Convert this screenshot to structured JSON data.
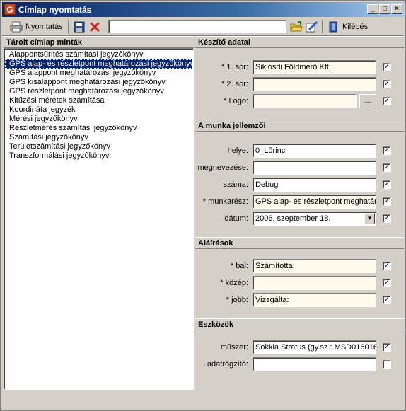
{
  "window": {
    "title": "Címlap nyomtatás",
    "app_icon_letter": "G",
    "controls": [
      "_",
      "□",
      "×"
    ]
  },
  "toolbar": {
    "print_label": "Nyomtatás",
    "search_value": "",
    "exit_label": "Kilépés"
  },
  "left": {
    "header": "Tárolt címlap minták",
    "items": [
      "Alappontsűrítés számítási jegyzőkönyv",
      "GPS alap- és részletpont meghatározási jegyzőkönyv",
      "GPS alappont meghatározási jegyzőkönyv",
      "GPS kisalappont meghatározási jegyzőkönyv",
      "GPS részletpont meghatározási jegyzőkönyv",
      "Kitűzési méretek számítása",
      "Koordináta jegyzék",
      "Mérési jegyzőkönyv",
      "Részletmérés számítási jegyzőkönyv",
      "Számítási jegyzőkönyv",
      "Területszámítási jegyzőkönyv",
      "Transzformálási jegyzőkönyv"
    ],
    "selected_index": 1
  },
  "sections": {
    "keszito": {
      "header": "Készítő adatai",
      "row1_label": "* 1. sor:",
      "row1_value": "Siklósdi Földmérő Kft.",
      "row1_checked": "✓",
      "row2_label": "* 2. sor:",
      "row2_value": "",
      "row2_checked": "✓",
      "logo_label": "* Logo:",
      "logo_value": "",
      "logo_browse": "...",
      "logo_checked": "✓"
    },
    "munka": {
      "header": "A munka jellemzői",
      "helye_label": "helye:",
      "helye_value": "0_Lőrinci",
      "helye_checked": "✓",
      "megnevezes_label": "megnevezése:",
      "megnevezes_value": "",
      "megnevezes_checked": "✓",
      "szama_label": "száma:",
      "szama_value": "Debug",
      "szama_checked": "✓",
      "munkaresz_label": "* munkarész:",
      "munkaresz_value": "GPS alap- és részletpont meghatáro",
      "munkaresz_checked": "✓",
      "datum_label": "dátum:",
      "datum_value": "2006. szeptember 18.",
      "datum_checked": "✓"
    },
    "alairasok": {
      "header": "Aláírások",
      "bal_label": "* bal:",
      "bal_value": "Számította:",
      "bal_checked": "✓",
      "kozep_label": "* közép:",
      "kozep_value": "",
      "kozep_checked": "✓",
      "jobb_label": "* jobb:",
      "jobb_value": "Vizsgálta:",
      "jobb_checked": "✓"
    },
    "eszkozok": {
      "header": "Eszközök",
      "muszer_label": "műszer:",
      "muszer_value": "Sokkia Stratus (gy.sz.: MSD016016",
      "muszer_checked": "✓",
      "adatrogzito_label": "adatrögzítő:",
      "adatrogzito_value": "",
      "adatrogzito_checked": ""
    }
  }
}
